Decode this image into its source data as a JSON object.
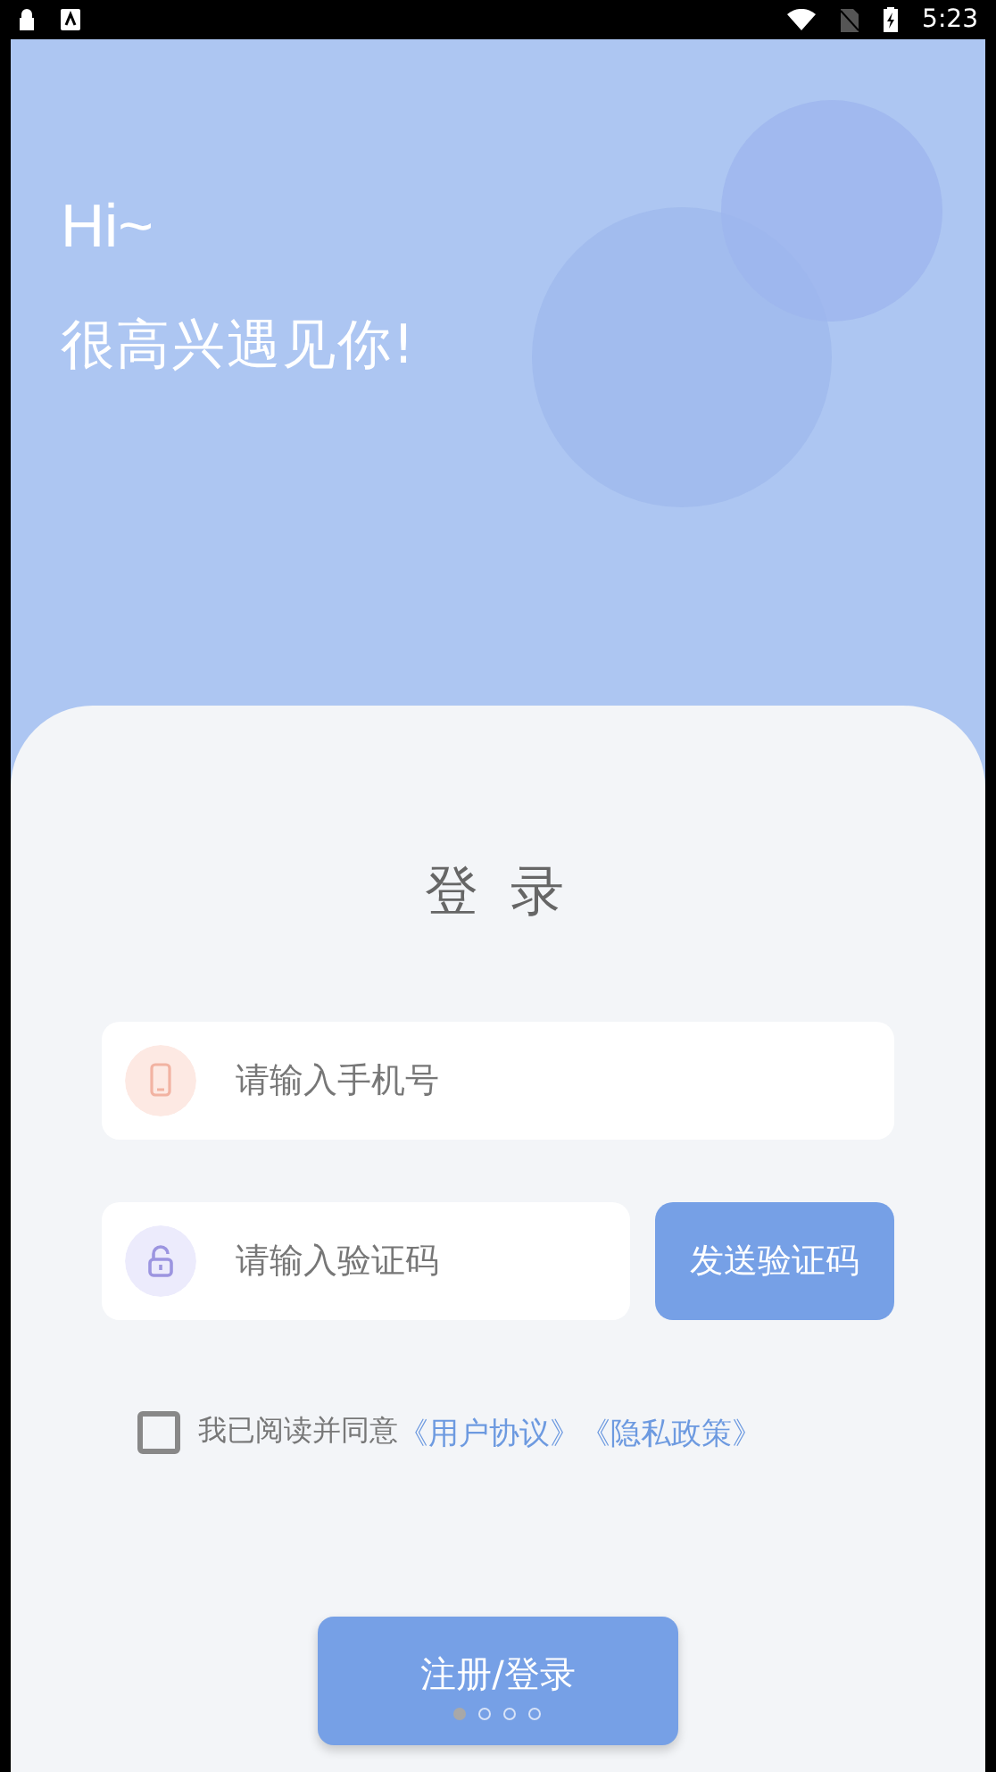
{
  "status_bar": {
    "time": "5:23"
  },
  "greeting": {
    "line_1": "Hi~",
    "line_2": "很高兴遇见你!"
  },
  "login": {
    "title": "登 录",
    "phone_field": {
      "placeholder": "请输入手机号"
    },
    "code_field": {
      "placeholder": "请输入验证码"
    },
    "send_code_button": "发送验证码",
    "agreement": {
      "checked": false,
      "text": "我已阅读并同意",
      "links": [
        "《用户协议》",
        "《隐私政策》"
      ]
    },
    "submit_button": "注册/登录",
    "pager": [
      {
        "selected": true
      },
      {
        "selected": false
      },
      {
        "selected": false
      },
      {
        "selected": false
      }
    ]
  }
}
